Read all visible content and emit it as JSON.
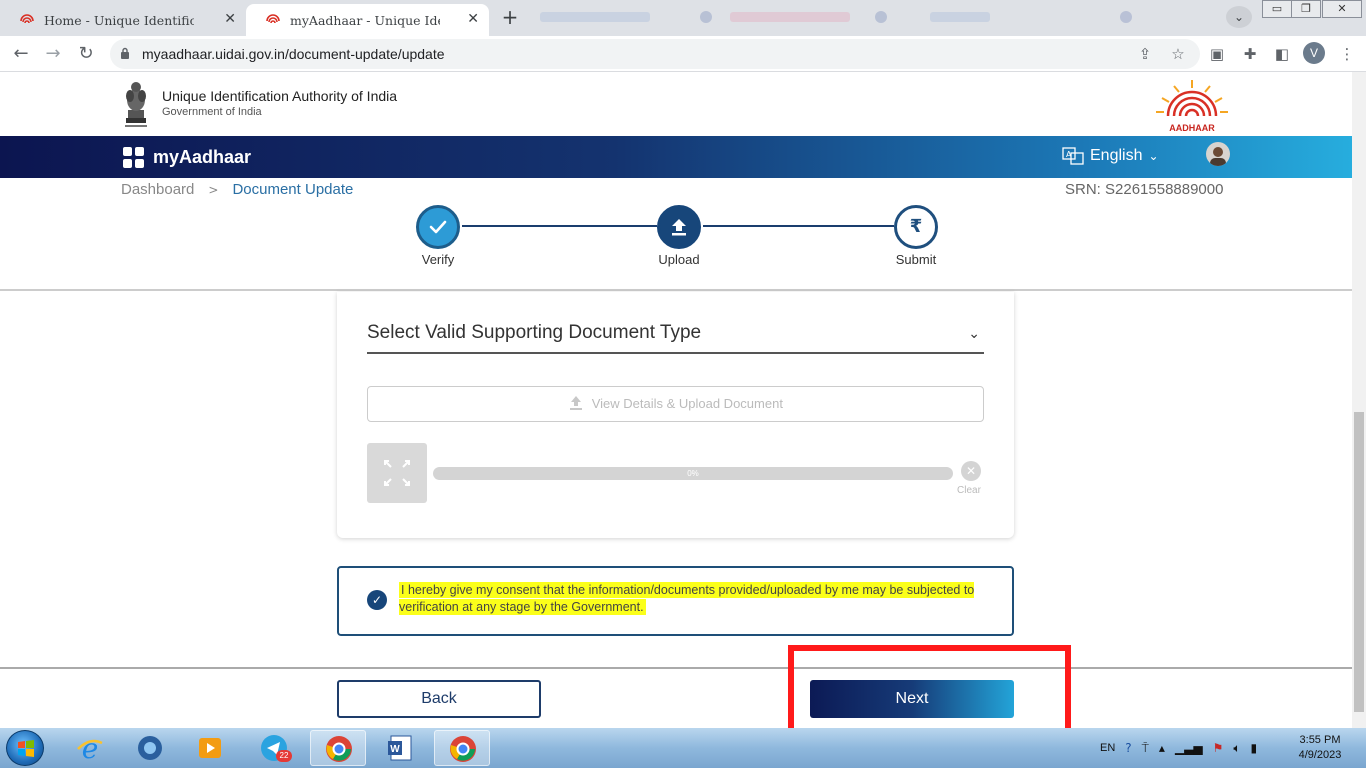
{
  "browser": {
    "tabs": [
      {
        "title": "Home - Unique Identification Au",
        "active": false
      },
      {
        "title": "myAadhaar - Unique Identificatio",
        "active": true
      }
    ],
    "url": "myaadhaar.uidai.gov.in/document-update/update",
    "profile_initial": "V"
  },
  "site": {
    "org_name": "Unique Identification Authority of India",
    "gov_name": "Government of India",
    "logo_text": "AADHAAR",
    "app_name": "myAadhaar",
    "language": "English"
  },
  "breadcrumb": {
    "dashboard": "Dashboard",
    "separator": ">",
    "current": "Document Update"
  },
  "srn": "SRN: S2261558889000",
  "stepper": {
    "steps": [
      {
        "label": "Verify",
        "state": "complete"
      },
      {
        "label": "Upload",
        "state": "current"
      },
      {
        "label": "Submit",
        "state": "pending"
      }
    ],
    "submit_symbol": "₹"
  },
  "document_card": {
    "select_placeholder": "Select Valid Supporting Document Type",
    "upload_button": "View Details & Upload Document",
    "progress_text": "0%",
    "progress_value": 0,
    "clear_label": "Clear"
  },
  "consent": {
    "checked": true,
    "text": "I hereby give my consent that the information/documents provided/uploaded by me may be subjected to verification at any stage by the Government."
  },
  "actions": {
    "back": "Back",
    "next": "Next"
  },
  "taskbar": {
    "language": "EN",
    "time": "3:55 PM",
    "date": "4/9/2023",
    "badge_count": "22"
  },
  "colors": {
    "primary_navy": "#17467a",
    "accent_blue": "#27b0e0",
    "highlight_yellow": "#fbff1a",
    "annotation_red": "#ff1a1a"
  }
}
